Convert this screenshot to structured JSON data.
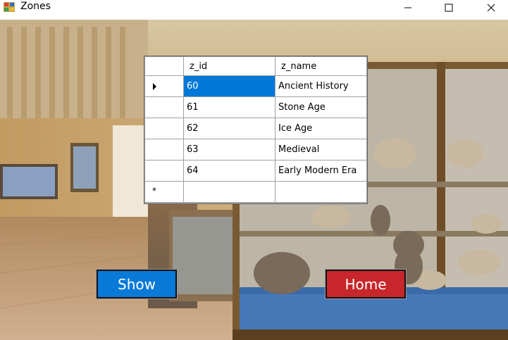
{
  "window": {
    "title": "Zones",
    "controls": {
      "minimize_icon": "minimize-icon",
      "maximize_icon": "maximize-icon",
      "close_icon": "close-icon"
    }
  },
  "grid": {
    "columns": [
      "z_id",
      "z_name"
    ],
    "rows": [
      {
        "z_id": "60",
        "z_name": "Ancient History",
        "current": true
      },
      {
        "z_id": "61",
        "z_name": "Stone Age"
      },
      {
        "z_id": "62",
        "z_name": "Ice Age"
      },
      {
        "z_id": "63",
        "z_name": "Medieval"
      },
      {
        "z_id": "64",
        "z_name": "Early Modern Era"
      }
    ],
    "new_row_marker": "*",
    "selection_color": "#0078d7"
  },
  "buttons": {
    "show_label": "Show",
    "home_label": "Home",
    "show_color": "#0a7ad8",
    "home_color": "#c7262a"
  },
  "background": {
    "icon": "museum-gallery-photo"
  }
}
